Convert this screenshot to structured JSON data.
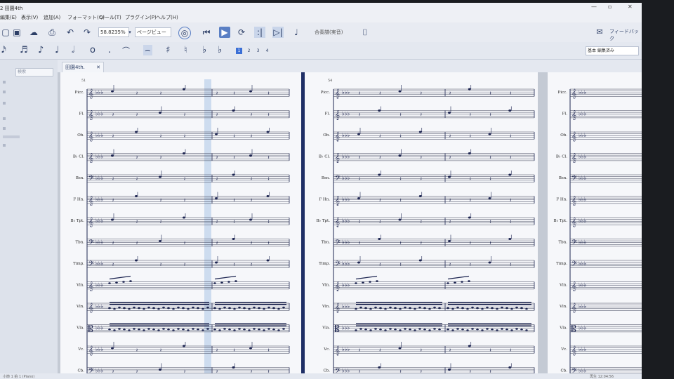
{
  "window": {
    "title": "2 田園4th"
  },
  "menu": [
    "編集(E)",
    "表示(V)",
    "追加(A)",
    "フォーマット(O)",
    "ツール(T)",
    "プラグイン(P)",
    "ヘルプ(H)"
  ],
  "toolbar": {
    "zoom": "58.8235%",
    "view": "ページビュー",
    "playback_label": "合奏譜(実音)",
    "feedback": "フィードバック"
  },
  "notebar": {
    "voices": [
      "1",
      "2",
      "3",
      "4"
    ],
    "workspace": "基本 編集済み"
  },
  "palette": {
    "search_placeholder": "検索"
  },
  "tab": {
    "label": "田園4th."
  },
  "score": {
    "instruments": [
      "Picc.",
      "Fl.",
      "Ob.",
      "B♭ Cl.",
      "Bsn.",
      "F Hn.",
      "B♭ Tpt.",
      "Tbn.",
      "Timp.",
      "Vln.",
      "Vln.",
      "Vla.",
      "Vc.",
      "Cb."
    ],
    "measure_numbers": [
      "51",
      "54"
    ]
  },
  "status": {
    "left": "小節 1 拍 1 (Piano)",
    "right": "再生 12:04:56"
  },
  "colors": {
    "accent": "#3b6fd6",
    "divider": "#1f2f66",
    "ink": "#1c2450",
    "playhead": "#bcd0ea"
  }
}
